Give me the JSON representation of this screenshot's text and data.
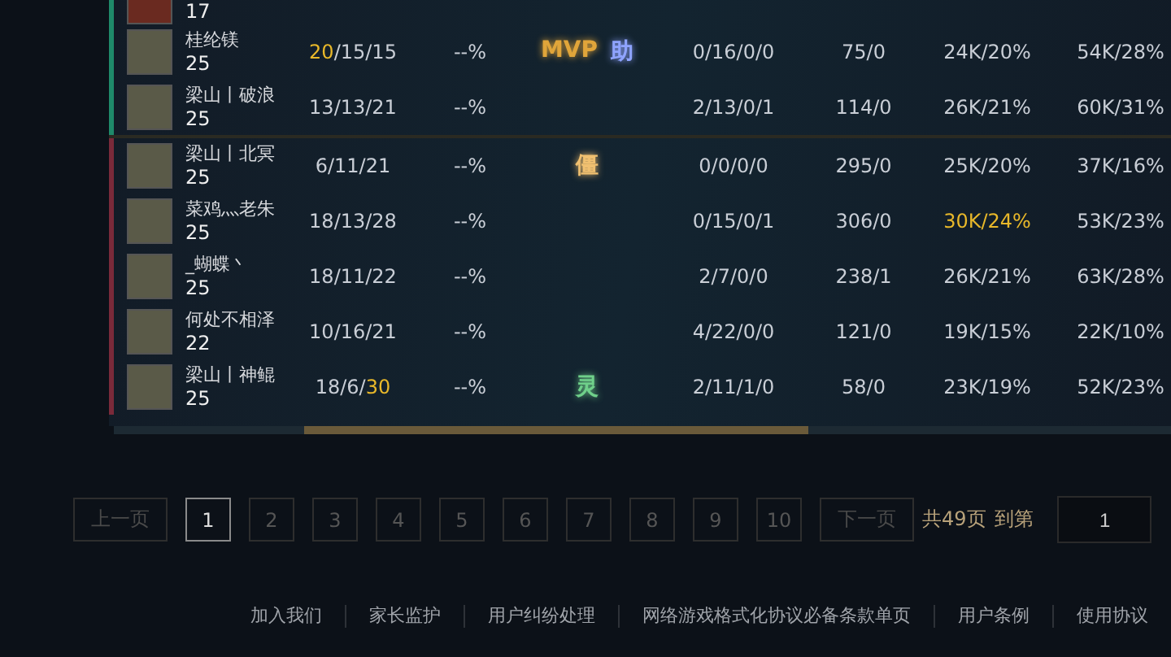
{
  "teams": [
    {
      "color": "#1f8a6a",
      "rows": [
        {
          "kind": "cut",
          "level": "17"
        },
        {
          "kind": "full",
          "name": "桂纶镁",
          "level": "25",
          "kda": [
            {
              "text": "20",
              "highlight": true
            },
            {
              "text": "/15/15",
              "highlight": false
            }
          ],
          "rate": "--%",
          "badges": [
            {
              "text": "MVP",
              "color": "#e0a53a"
            },
            {
              "text": "助",
              "color": "#8fa4ff"
            }
          ],
          "stats": "0/16/0/0",
          "cs": "75/0",
          "damage": {
            "text": "24K/20%",
            "highlight": false
          },
          "taken": "54K/28%"
        },
        {
          "kind": "full",
          "name": "梁山丨破浪",
          "level": "25",
          "kda": [
            {
              "text": "13/13/21",
              "highlight": false
            }
          ],
          "rate": "--%",
          "badges": [],
          "stats": "2/13/0/1",
          "cs": "114/0",
          "damage": {
            "text": "26K/21%",
            "highlight": false
          },
          "taken": "60K/31%"
        }
      ]
    },
    {
      "color": "#7a2a3a",
      "rows": [
        {
          "kind": "full",
          "name": "梁山丨北冥",
          "level": "25",
          "kda": [
            {
              "text": "6/11/21",
              "highlight": false
            }
          ],
          "rate": "--%",
          "badges": [
            {
              "text": "僵",
              "color": "#f0c070"
            }
          ],
          "stats": "0/0/0/0",
          "cs": "295/0",
          "damage": {
            "text": "25K/20%",
            "highlight": false
          },
          "taken": "37K/16%"
        },
        {
          "kind": "full",
          "name": "菜鸡灬老朱",
          "level": "25",
          "kda": [
            {
              "text": "18/13/28",
              "highlight": false
            }
          ],
          "rate": "--%",
          "badges": [],
          "stats": "0/15/0/1",
          "cs": "306/0",
          "damage": {
            "text": "30K/24%",
            "highlight": true
          },
          "taken": "53K/23%"
        },
        {
          "kind": "full",
          "name": "_蝴蝶丶",
          "level": "25",
          "kda": [
            {
              "text": "18/11/22",
              "highlight": false
            }
          ],
          "rate": "--%",
          "badges": [],
          "stats": "2/7/0/0",
          "cs": "238/1",
          "damage": {
            "text": "26K/21%",
            "highlight": false
          },
          "taken": "63K/28%"
        },
        {
          "kind": "full",
          "name": "何处不相泽",
          "level": "22",
          "kda": [
            {
              "text": "10/16/21",
              "highlight": false
            }
          ],
          "rate": "--%",
          "badges": [],
          "stats": "4/22/0/0",
          "cs": "121/0",
          "damage": {
            "text": "19K/15%",
            "highlight": false
          },
          "taken": "22K/10%"
        },
        {
          "kind": "full",
          "name": "梁山丨神鲲",
          "level": "25",
          "kda": [
            {
              "text": "18/6/",
              "highlight": false
            },
            {
              "text": "30",
              "highlight": true
            }
          ],
          "rate": "--%",
          "badges": [
            {
              "text": "灵",
              "color": "#6fd08a"
            }
          ],
          "stats": "2/11/1/0",
          "cs": "58/0",
          "damage": {
            "text": "23K/19%",
            "highlight": false
          },
          "taken": "52K/23%"
        }
      ]
    }
  ],
  "pagination": {
    "prev": {
      "label": "上一页",
      "disabled": true
    },
    "pages": [
      {
        "label": "1",
        "selected": true
      },
      {
        "label": "2",
        "selected": false
      },
      {
        "label": "3",
        "selected": false
      },
      {
        "label": "4",
        "selected": false
      },
      {
        "label": "5",
        "selected": false
      },
      {
        "label": "6",
        "selected": false
      },
      {
        "label": "7",
        "selected": false
      },
      {
        "label": "8",
        "selected": false
      },
      {
        "label": "9",
        "selected": false
      },
      {
        "label": "10",
        "selected": false
      }
    ],
    "next": {
      "label": "下一页",
      "disabled": true
    },
    "total": "共49页",
    "goto_label": "到第",
    "goto_value": "1"
  },
  "footer_links": [
    "加入我们",
    "家长监护",
    "用户纠纷处理",
    "网络游戏格式化协议必备条款单页",
    "用户条例",
    "使用协议"
  ]
}
